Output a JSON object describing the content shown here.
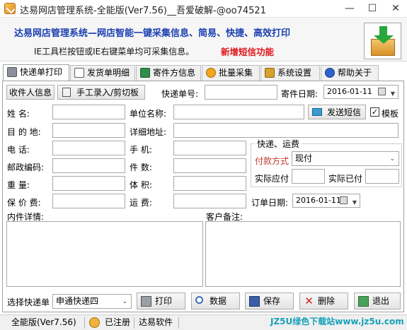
{
  "window": {
    "title": "达易网店管理系统-全能版(Ver7.56)__吾爱破解-@oo74521",
    "minimize": "—",
    "maximize": "☐",
    "close": "✕"
  },
  "banner": {
    "title": "达易网店管理系统—网店智能一键采集信息、简易、快捷、高效打印",
    "subtitle": "IE工具栏按钮或IE右键菜单均可采集信息。",
    "highlight": "新增短信功能",
    "highlight_color": "#e0161b",
    "title_color": "#1b3fb0"
  },
  "tabs": [
    {
      "label": "快递单打印",
      "icon": "printer-icon",
      "active": true
    },
    {
      "label": "发货单明细",
      "icon": "document-icon"
    },
    {
      "label": "寄件方信息",
      "icon": "card-icon"
    },
    {
      "label": "批量采集",
      "icon": "clock-icon"
    },
    {
      "label": "系统设置",
      "icon": "wrench-icon"
    },
    {
      "label": "帮助关于",
      "icon": "help-icon"
    }
  ],
  "toolbar": {
    "recipient_info": "收件人信息",
    "manual_entry": "手工录入/剪切板",
    "waybill_label": "快递单号:",
    "waybill_value": "",
    "send_date_label": "寄件日期:",
    "send_date_value": "2016-01-11"
  },
  "form": {
    "name_label": "姓      名:",
    "company_label": "单位名称:",
    "dest_label": "目 的 地:",
    "address_label": "详细地址:",
    "phone_label": "电      话:",
    "mobile_label": "手      机:",
    "zip_label": "邮政编码:",
    "pieces_label": "件      数:",
    "weight_label": "重      量:",
    "volume_label": "体      积:",
    "insured_label": "保 价 费:",
    "freight_label": "运      费:",
    "send_sms": "发送短信",
    "template_label": "模板",
    "template_checked": "✓",
    "order_date_label": "订单日期:",
    "order_date_value": "2016-01-11",
    "contents_label": "内件详情:",
    "remark_label": "客户备注:"
  },
  "shipping": {
    "legend": "快递、运费",
    "payment_label": "付款方式",
    "payment_value": "现付",
    "receivable_label": "实际应付",
    "paid_label": "实际已付"
  },
  "bottom": {
    "courier_label": "选择快递单",
    "courier_value": "申通快递四",
    "print": "打印",
    "data": "数据",
    "save": "保存",
    "delete": "删除",
    "exit": "退出"
  },
  "status": {
    "edition": "全能版(Ver7.56)",
    "registered": "已注册",
    "software": "达易软件",
    "watermark": "JZ5U绿色下载站www.jz5u.com"
  }
}
